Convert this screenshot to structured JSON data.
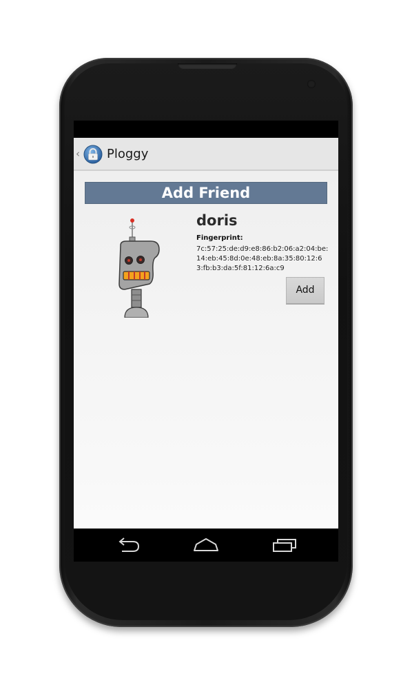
{
  "app": {
    "title": "Ploggy",
    "up_caret": "‹",
    "icon": "lock-icon"
  },
  "screen": {
    "header": "Add Friend"
  },
  "friend": {
    "name": "doris",
    "fingerprint_label": "Fingerprint:",
    "fingerprint": "7c:57:25:de:d9:e8:86:b2:06:a2:04:be:14:eb:45:8d:0e:48:eb:8a:35:80:12:63:fb:b3:da:5f:81:12:6a:c9",
    "avatar": "robot-avatar",
    "add_label": "Add"
  },
  "navigation": {
    "back": "back-icon",
    "home": "home-icon",
    "recents": "recent-apps-icon"
  },
  "colors": {
    "banner": "#637994",
    "actionbar": "#e6e6e6",
    "button": "#d0d0d0"
  }
}
